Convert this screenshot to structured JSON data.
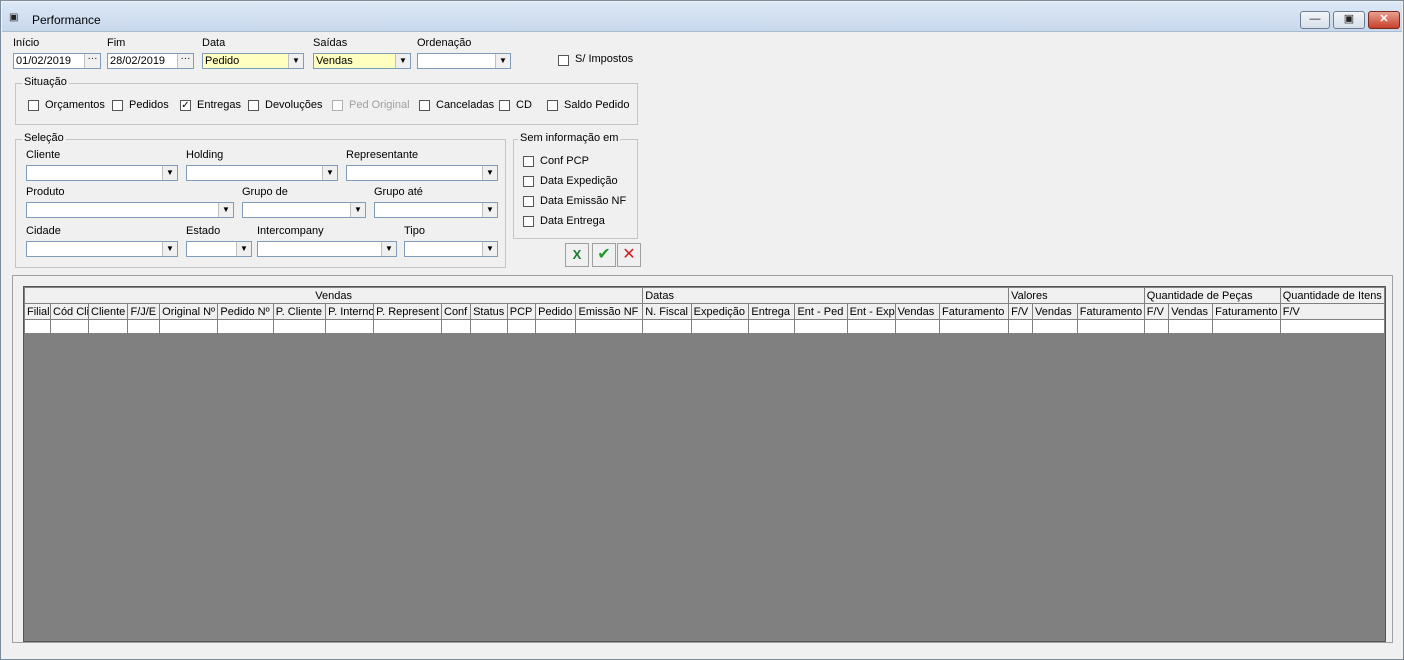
{
  "window": {
    "title": "Performance"
  },
  "filters": {
    "inicio_label": "Início",
    "inicio_value": "01/02/2019",
    "fim_label": "Fim",
    "fim_value": "28/02/2019",
    "data_label": "Data",
    "data_value": "Pedido",
    "saidas_label": "Saídas",
    "saidas_value": "Vendas",
    "ordenacao_label": "Ordenação",
    "ordenacao_value": "",
    "sem_impostos_label": "S/ Impostos",
    "sem_impostos_checked": false
  },
  "situacao": {
    "title": "Situação",
    "options": [
      {
        "label": "Orçamentos",
        "checked": false,
        "disabled": false
      },
      {
        "label": "Pedidos",
        "checked": false,
        "disabled": false
      },
      {
        "label": "Entregas",
        "checked": true,
        "disabled": false
      },
      {
        "label": "Devoluções",
        "checked": false,
        "disabled": false
      },
      {
        "label": "Ped Original",
        "checked": false,
        "disabled": true
      },
      {
        "label": "Canceladas",
        "checked": false,
        "disabled": false
      },
      {
        "label": "CD",
        "checked": false,
        "disabled": false
      },
      {
        "label": "Saldo Pedido",
        "checked": false,
        "disabled": false
      }
    ]
  },
  "selecao": {
    "title": "Seleção",
    "cliente": "Cliente",
    "holding": "Holding",
    "representante": "Representante",
    "produto": "Produto",
    "grupo_de": "Grupo de",
    "grupo_ate": "Grupo até",
    "cidade": "Cidade",
    "estado": "Estado",
    "intercompany": "Intercompany",
    "tipo": "Tipo"
  },
  "sem_info": {
    "title": "Sem informação em",
    "options": [
      "Conf PCP",
      "Data Expedição",
      "Data Emissão NF",
      "Data Entrega"
    ]
  },
  "actions": {
    "excel_icon": "excel-icon",
    "confirm_icon": "check-icon",
    "cancel_icon": "close-icon"
  },
  "grid": {
    "groups": [
      {
        "label": "Vendas",
        "span": 14
      },
      {
        "label": "Datas",
        "span": 7
      },
      {
        "label": "Valores",
        "span": 3
      },
      {
        "label": "Quantidade de Peças",
        "span": 3
      },
      {
        "label": "Quantidade de Itens",
        "span": 3
      }
    ],
    "columns": [
      "Filial",
      "Cód Cli",
      "Cliente",
      "F/J/E",
      "Original Nº",
      "Pedido Nº",
      "P. Cliente",
      "P. Interno",
      "P. Represent",
      "Conf",
      "Status",
      "PCP",
      "Pedido",
      "Emissão NF",
      "N. Fiscal",
      "Expedição",
      "Entrega",
      "Ent - Ped",
      "Ent - Exp",
      "Vendas",
      "Faturamento",
      "F/V",
      "Vendas",
      "Faturamento",
      "F/V",
      "Vendas",
      "Faturamento",
      "F/V"
    ]
  }
}
